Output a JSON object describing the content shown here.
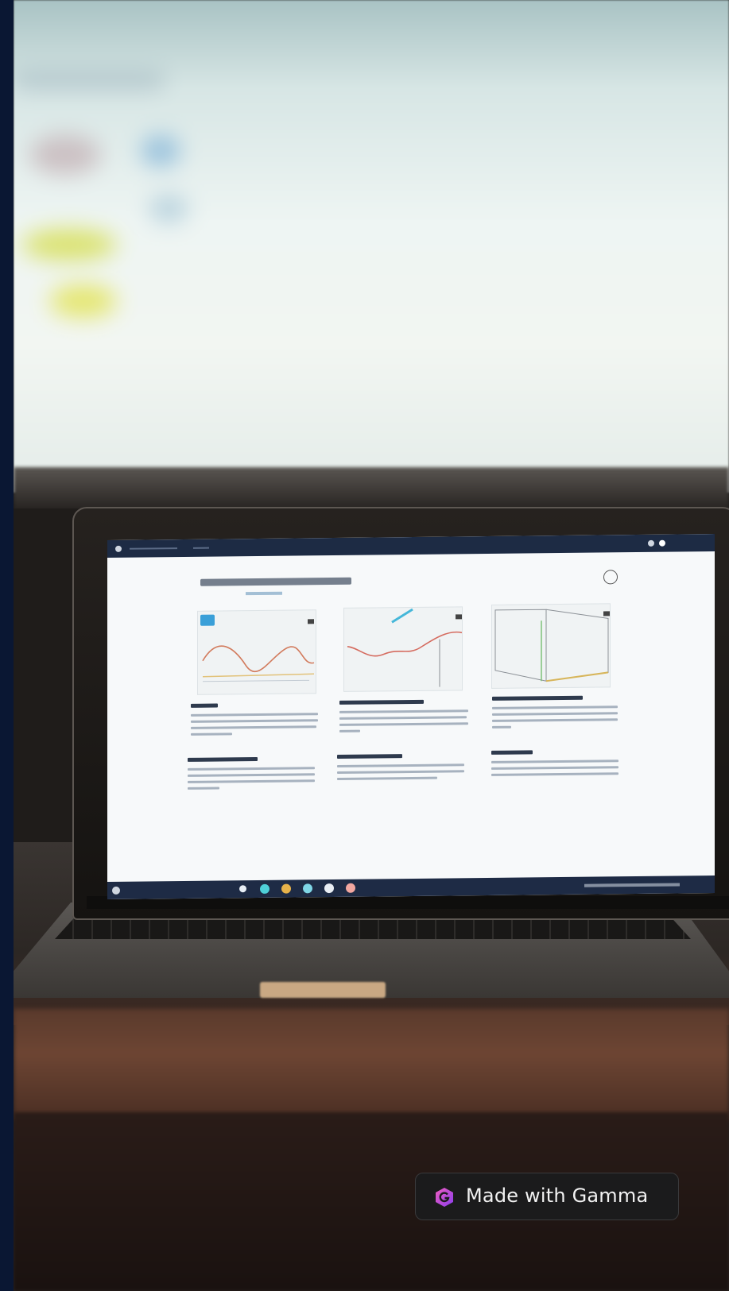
{
  "badge": {
    "label": "Made with Gamma",
    "icon": "gamma-logo-icon",
    "background_color": "#1b1b1c",
    "text_color": "#f2f2f2"
  },
  "scene": {
    "accent_color": "#0a1733"
  }
}
